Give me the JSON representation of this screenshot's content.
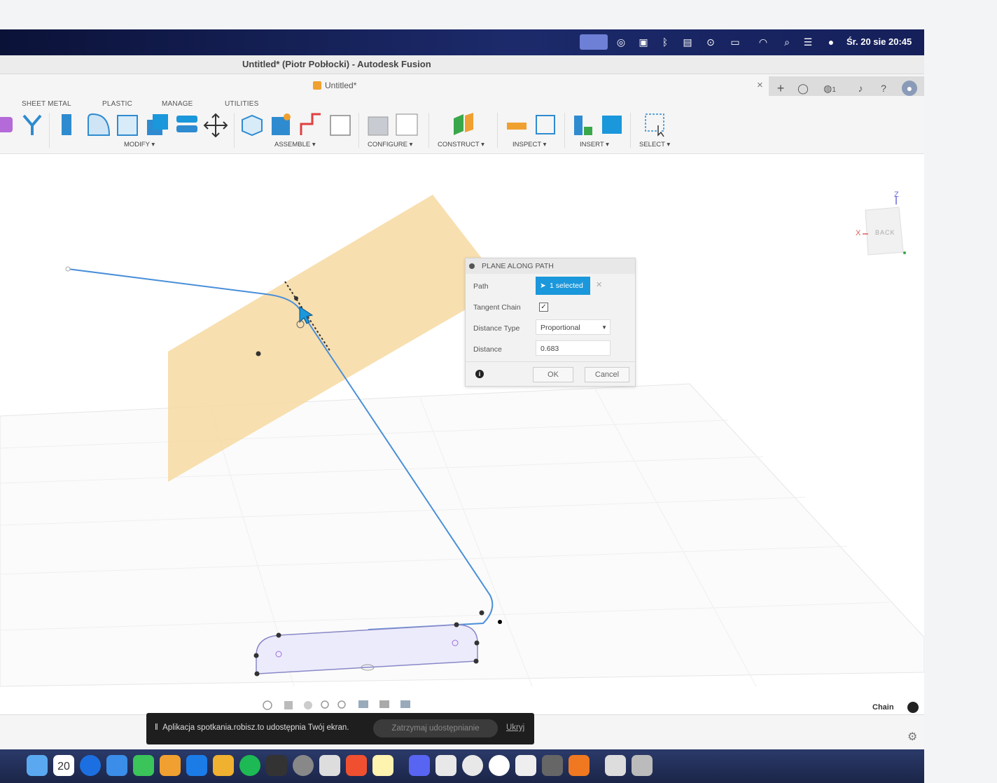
{
  "menubar": {
    "clock": "Śr. 20 sie 20:45",
    "icons": [
      "screen-share-icon",
      "target-icon",
      "drive-icon",
      "bluetooth-icon",
      "keyboard-icon",
      "play-icon",
      "battery-icon",
      "wifi-icon",
      "search-icon",
      "control-center-icon",
      "siri-icon"
    ]
  },
  "window": {
    "title": "Untitled* (Piotr Pobłocki) - Autodesk Fusion"
  },
  "doc_tab": {
    "label": "Untitled*",
    "close": "×",
    "add": "+",
    "job_count": "1"
  },
  "toolbar": {
    "tabs": [
      "SHEET METAL",
      "PLASTIC",
      "MANAGE",
      "UTILITIES"
    ],
    "groups": [
      "MODIFY ▾",
      "ASSEMBLE ▾",
      "CONFIGURE ▾",
      "CONSTRUCT ▾",
      "INSPECT ▾",
      "INSERT ▾",
      "SELECT ▾"
    ]
  },
  "viewcube": {
    "face": "BACK",
    "axis_z": "Z",
    "axis_x": "X"
  },
  "dialog": {
    "title": "PLANE ALONG PATH",
    "path_label": "Path",
    "path_value": "1 selected",
    "tangent_label": "Tangent Chain",
    "tangent_checked": true,
    "distance_type_label": "Distance Type",
    "distance_type_value": "Proportional",
    "distance_label": "Distance",
    "distance_value": "0.683",
    "ok": "OK",
    "cancel": "Cancel"
  },
  "status": {
    "chain": "Chain"
  },
  "share_banner": {
    "message": "Aplikacja spotkania.robisz.to udostępnia Twój ekran.",
    "stop": "Zatrzymaj udostępnianie",
    "hide": "Ukryj"
  },
  "dock": {
    "calendar_day": "20"
  },
  "colors": {
    "accent": "#1b97db",
    "plane": "#f7d9a1",
    "path": "#4a8fd8",
    "menubar": "#15205a"
  }
}
